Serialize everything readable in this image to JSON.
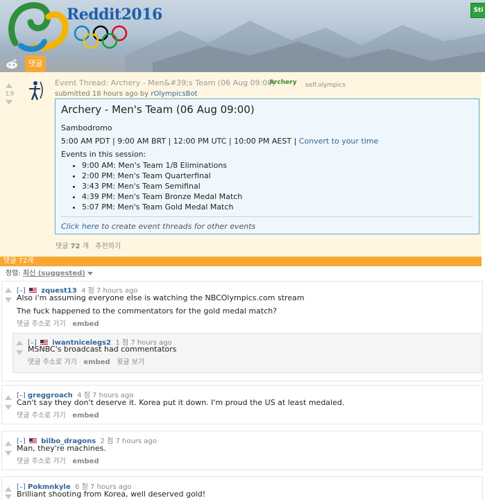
{
  "header": {
    "logo_text": "Reddit2016",
    "tab_comments": "댓글",
    "corner_button": "Sti"
  },
  "post": {
    "score": "19",
    "title": "Event Thread: Archery - Men&#39;s Team (06 Aug 09:00)",
    "flair": "Archery",
    "domain": "self.olympics",
    "submitted": "submitted 18 hours ago by",
    "author": "rOlympicsBot",
    "selftext": {
      "heading": "Archery - Men's Team (06 Aug 09:00)",
      "venue": "Sambodromo",
      "times": "5:00 AM PDT | 9:00 AM BRT | 12:00 PM UTC | 10:00 PM AEST |",
      "convert_link": "Convert to your time",
      "events_label": "Events in this session:",
      "events": [
        "9:00 AM: Men's Team 1/8 Eliminations",
        "2:00 PM: Men's Team Quarterfinal",
        "3:43 PM: Men's Team Semifinal",
        "4:39 PM: Men's Team Bronze Medal Match",
        "5:07 PM: Men's Team Gold Medal Match"
      ],
      "footer_link": "Click here",
      "footer_rest": "to create event threads for other events"
    },
    "buttons": {
      "comments_prefix": "댓글",
      "comments_count": "72",
      "comments_suffix": "개",
      "recommend": "추천하기"
    }
  },
  "comments_bar": "댓글 72개",
  "sort": {
    "label": "정렬:",
    "selected": "최신 (suggested)"
  },
  "comments": [
    {
      "toggle": "[–]",
      "user": "zquest13",
      "points": "4 점 7 hours ago",
      "body": [
        "Also i'm assuming everyone else is watching the NBCOlympics.com stream",
        "The fuck happened to the commentators for the gold medal match?"
      ],
      "buttons": [
        "댓글 주소로 가기",
        "embed"
      ]
    },
    {
      "toggle": "[–]",
      "user": "iwantnicelegs2",
      "points": "1 점 7 hours ago",
      "body": [
        "MSNBC's broadcast had commentators"
      ],
      "buttons": [
        "댓글 주소로 가기",
        "embed",
        "윗글 보기"
      ]
    },
    {
      "toggle": "[–]",
      "user": "greggroach",
      "points": "4 점 7 hours ago",
      "body": [
        "Can't say they don't deserve it. Korea put it down. I'm proud the US at least medaled."
      ],
      "buttons": [
        "댓글 주소로 가기",
        "embed"
      ]
    },
    {
      "toggle": "[–]",
      "user": "bilbo_dragons",
      "points": "2 점 7 hours ago",
      "body": [
        "Man, they're machines."
      ],
      "buttons": [
        "댓글 주소로 가기",
        "embed"
      ]
    },
    {
      "toggle": "[–]",
      "user": "Pokmnkyle",
      "points": "6 점 7 hours ago",
      "body": [
        "Brilliant shooting from Korea, well deserved gold!"
      ],
      "buttons": []
    }
  ]
}
